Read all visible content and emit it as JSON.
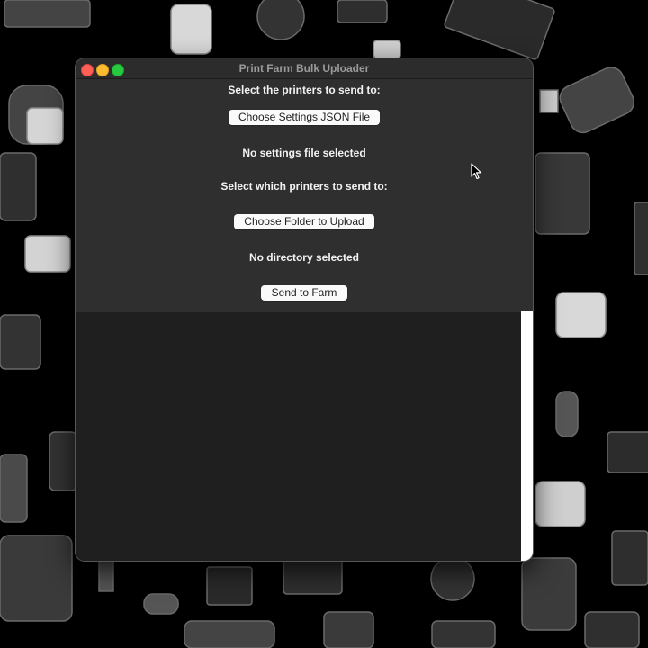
{
  "window": {
    "title": "Print Farm Bulk Uploader"
  },
  "form": {
    "printers_heading": "Select the printers to send to:",
    "choose_settings_label": "Choose Settings JSON File",
    "settings_status": "No settings file selected",
    "which_printers_heading": "Select which printers to send to:",
    "choose_folder_label": "Choose Folder to Upload",
    "directory_status": "No directory selected",
    "send_label": "Send to Farm"
  },
  "colors": {
    "close": "#fe5f57",
    "minimize": "#febc2e",
    "zoom": "#28c840",
    "panel": "#2f2f2f",
    "window_bg": "#1f1f1f"
  },
  "icons": [
    "close-button",
    "minimize-button",
    "zoom-button",
    "mouse-pointer-icon"
  ]
}
